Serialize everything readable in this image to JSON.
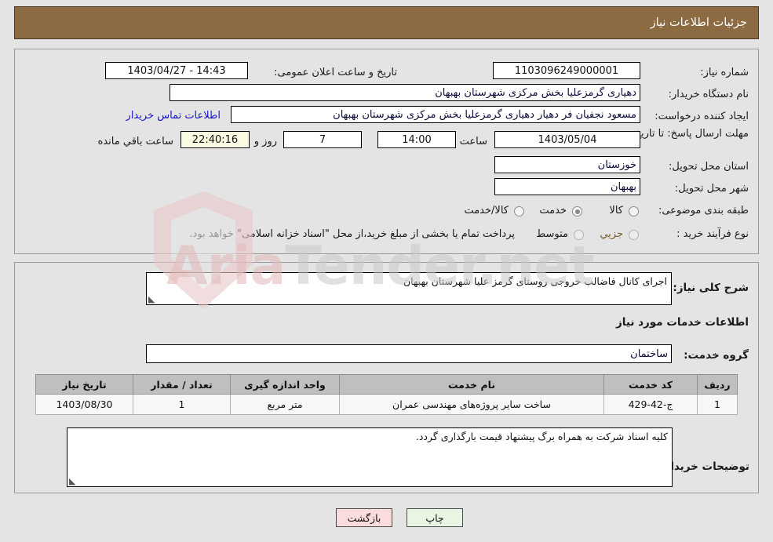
{
  "header": {
    "title": "جزئیات اطلاعات نیاز"
  },
  "form": {
    "need_number_label": "شماره نیاز:",
    "need_number_value": "1103096249000001",
    "announce_datetime_label": "تاریخ و ساعت اعلان عمومی:",
    "announce_datetime_value": "1403/04/27 - 14:43",
    "buyer_org_label": "نام دستگاه خریدار:",
    "buyer_org_value": "دهیاری گرمزعلیا بخش مرکزی شهرستان بهبهان",
    "requester_label": "ایجاد کننده درخواست:",
    "requester_value": "مسعود نجفیان فر دهیار  دهیاری گرمزعلیا بخش مرکزی شهرستان بهبهان",
    "buyer_contact_link": "اطلاعات تماس خریدار",
    "deadline_label": "مهلت ارسال پاسخ: تا تاریخ:",
    "deadline_date": "1403/05/04",
    "deadline_time_label": "ساعت",
    "deadline_time": "14:00",
    "remaining_days": "7",
    "remaining_days_label": "روز و",
    "remaining_time": "22:40:16",
    "remaining_suffix_label": "ساعت باقي مانده",
    "province_label": "استان محل تحویل:",
    "province_value": "خوزستان",
    "city_label": "شهر محل تحویل:",
    "city_value": "بهبهان",
    "category_label": "طبقه بندی موضوعی:",
    "category_options": [
      "کالا",
      "خدمت",
      "کالا/خدمت"
    ],
    "category_selected_index": 1,
    "process_type_label": "نوع فرآیند خرید :",
    "process_options": [
      "جزیي",
      "متوسط"
    ],
    "process_selected_index": -1,
    "process_note": "پرداخت تمام یا بخشی از مبلغ خرید،از محل \"اسناد خزانه اسلامی\" خواهد بود."
  },
  "description": {
    "label": "شرح کلی نیاز:",
    "value": "اجرای کانال فاضالب خروجی روستای گرمز علیا شهرستان بهبهان"
  },
  "services": {
    "section_title": "اطلاعات خدمات مورد نیاز",
    "group_label": "گروه خدمت:",
    "group_value": "ساختمان",
    "columns": [
      "ردیف",
      "کد خدمت",
      "نام خدمت",
      "واحد اندازه گیری",
      "تعداد / مقدار",
      "تاریخ نیاز"
    ],
    "rows": [
      {
        "index": "1",
        "code": "ج-42-429",
        "name": "ساخت سایر پروژه‌های مهندسی عمران",
        "unit": "متر مربع",
        "quantity": "1",
        "need_date": "1403/08/30"
      }
    ]
  },
  "buyer_notes": {
    "label": "توضیحات خریدار:",
    "value": "کلیه اسناد شرکت به همراه برگ پیشنهاد قیمت بارگذاری گردد."
  },
  "footer": {
    "print_label": "چاپ",
    "back_label": "بازگشت"
  },
  "watermark": {
    "text_left": "Aria",
    "text_right": "Tender.net"
  },
  "colors": {
    "header_bg": "#8d6b42",
    "page_bg": "#e4e4e4",
    "link": "#1414d2",
    "print_btn": "#e8f5e2",
    "back_btn": "#fbdcdc",
    "table_header": "#bfbfbf"
  }
}
